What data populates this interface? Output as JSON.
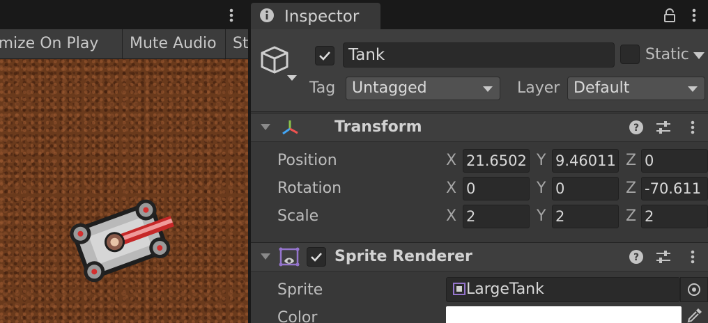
{
  "game_view": {
    "toolbar": {
      "maximize_label": "Maximize On Play",
      "mute_label": "Mute Audio",
      "stats_label": "Stats"
    }
  },
  "inspector": {
    "tab_title": "Inspector",
    "game_object": {
      "name": "Tank",
      "active": true,
      "static_label": "Static",
      "tag_label": "Tag",
      "tag_value": "Untagged",
      "layer_label": "Layer",
      "layer_value": "Default"
    },
    "transform": {
      "title": "Transform",
      "axis_x": "X",
      "axis_y": "Y",
      "axis_z": "Z",
      "position": {
        "label": "Position",
        "x": "21.6502",
        "y": "9.46011",
        "z": "0"
      },
      "rotation": {
        "label": "Rotation",
        "x": "0",
        "y": "0",
        "z": "-70.611"
      },
      "scale": {
        "label": "Scale",
        "x": "2",
        "y": "2",
        "z": "2"
      }
    },
    "sprite_renderer": {
      "title": "Sprite Renderer",
      "enabled": true,
      "sprite_label": "Sprite",
      "sprite_value": "LargeTank",
      "color_label": "Color",
      "color_value": "#ffffff"
    }
  },
  "colors": {
    "panel": "#383838",
    "header": "#3e3e3e",
    "field": "#2a2a2a",
    "dirt": "#6a3a1c"
  }
}
